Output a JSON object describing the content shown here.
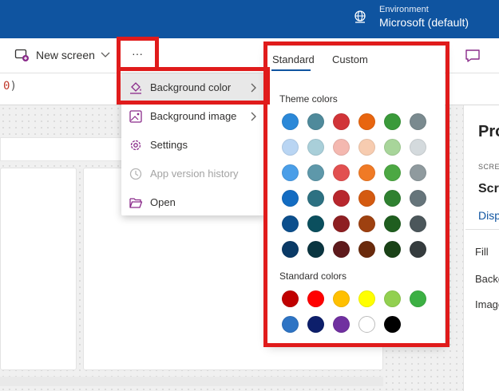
{
  "header": {
    "environment_label": "Environment",
    "environment_value": "Microsoft (default)",
    "bg_color": "#0f54a0"
  },
  "toolbar": {
    "new_screen_label": "New screen",
    "more_label": "···"
  },
  "formula": {
    "value": "0",
    "close_paren": ")"
  },
  "menu": {
    "items": [
      {
        "label": "Background color",
        "icon": "paint-bucket-icon",
        "submenu": true,
        "active": true
      },
      {
        "label": "Background image",
        "icon": "image-icon",
        "submenu": true
      },
      {
        "label": "Settings",
        "icon": "gear-icon"
      },
      {
        "label": "App version history",
        "icon": "history-icon",
        "disabled": true
      },
      {
        "label": "Open",
        "icon": "folder-open-icon"
      }
    ]
  },
  "color_picker": {
    "tabs": [
      "Standard",
      "Custom"
    ],
    "selected_tab": "Standard",
    "theme_label": "Theme colors",
    "standard_label": "Standard colors",
    "theme_colors": [
      [
        "#2b88d8",
        "#4f8a9b",
        "#d13438",
        "#e8650f",
        "#3a9a3a",
        "#7a8a8f"
      ],
      [
        "#b9d5f3",
        "#a9cfd9",
        "#f4b8b0",
        "#f7ccb0",
        "#a8d59a",
        "#d4dadd"
      ],
      [
        "#4a9ee8",
        "#5e98aa",
        "#e25050",
        "#f07a25",
        "#4ca843",
        "#8f9a9e"
      ],
      [
        "#136cc2",
        "#2d7182",
        "#b8272d",
        "#d45a10",
        "#2f8130",
        "#66757b"
      ],
      [
        "#0c4f8d",
        "#0b4f5e",
        "#8e1f22",
        "#9e4110",
        "#1f5e1f",
        "#4c575b"
      ],
      [
        "#0a3a66",
        "#0a3540",
        "#5e1a1c",
        "#6a2a0c",
        "#1a4217",
        "#353c3e"
      ]
    ],
    "standard_colors": [
      [
        "#c00000",
        "#ff0000",
        "#ffc000",
        "#ffff00",
        "#92d050",
        "#3cb043"
      ],
      [
        "#2e74c4",
        "#0d1f6b",
        "#7030a0",
        "#ffffff",
        "#000000"
      ]
    ]
  },
  "properties_panel": {
    "title": "Pro",
    "screen_caption": "SCREE",
    "screen_name": "Scre",
    "tab": "Disp",
    "props": [
      "Fill",
      "Backg",
      "Image"
    ]
  },
  "highlight_color": "#e01b1b"
}
